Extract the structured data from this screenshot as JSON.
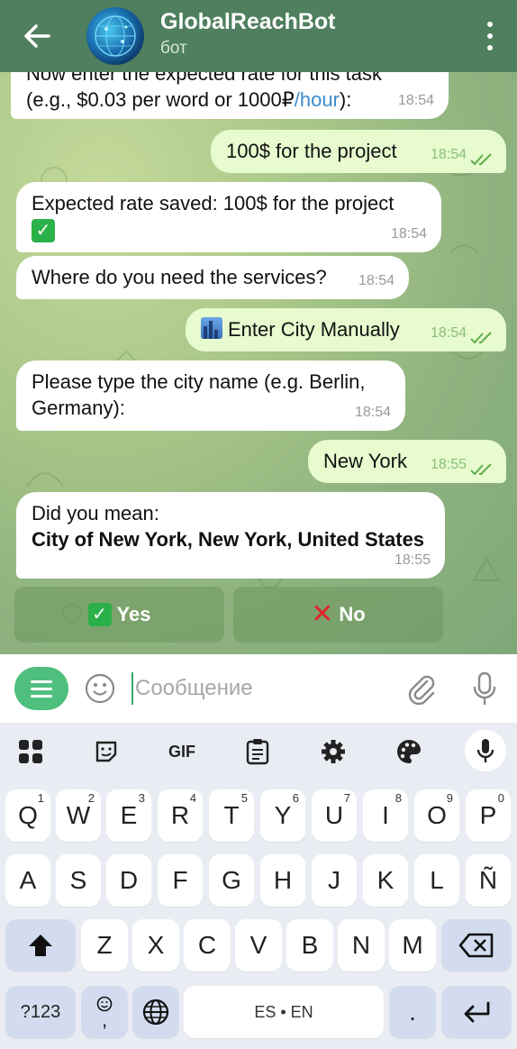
{
  "header": {
    "title": "GlobalReachBot",
    "subtitle": "бот"
  },
  "messages": [
    {
      "dir": "in",
      "line1": "Now enter the expected rate for this task",
      "line2_pre": "(e.g., $0.03 per word or 1000₽",
      "line2_link": "/hour",
      "line2_post": "):",
      "time": "18:54"
    },
    {
      "dir": "out",
      "text": "100$ for the project",
      "time": "18:54"
    },
    {
      "dir": "in",
      "text": "Expected rate saved: 100$ for the project",
      "emoji": "✓",
      "time": "18:54"
    },
    {
      "dir": "in",
      "text": "Where do you need the services?",
      "time": "18:54"
    },
    {
      "dir": "out",
      "text": "Enter City Manually",
      "time": "18:54"
    },
    {
      "dir": "in",
      "line1": "Please type the city name (e.g. Berlin,",
      "line2": "Germany):",
      "time": "18:54"
    },
    {
      "dir": "out",
      "text": "New York",
      "time": "18:55"
    },
    {
      "dir": "in",
      "line1": "Did you mean:",
      "line2": "City of New York, New York, United States",
      "time": "18:55"
    }
  ],
  "inline_keyboard": {
    "yes_label": "Yes",
    "no_label": "No"
  },
  "input": {
    "placeholder": "Сообщение",
    "value": ""
  },
  "keyboard": {
    "toolbar": [
      "apps-icon",
      "sticker-icon",
      "GIF",
      "clipboard-icon",
      "gear-icon",
      "palette-icon",
      "mic-icon"
    ],
    "gif_label": "GIF",
    "row1": [
      {
        "k": "Q",
        "n": "1"
      },
      {
        "k": "W",
        "n": "2"
      },
      {
        "k": "E",
        "n": "3"
      },
      {
        "k": "R",
        "n": "4"
      },
      {
        "k": "T",
        "n": "5"
      },
      {
        "k": "Y",
        "n": "6"
      },
      {
        "k": "U",
        "n": "7"
      },
      {
        "k": "I",
        "n": "8"
      },
      {
        "k": "O",
        "n": "9"
      },
      {
        "k": "P",
        "n": "0"
      }
    ],
    "row2": [
      "A",
      "S",
      "D",
      "F",
      "G",
      "H",
      "J",
      "K",
      "L",
      "Ñ"
    ],
    "row3": [
      "Z",
      "X",
      "C",
      "V",
      "B",
      "N",
      "M"
    ],
    "symbols_label": "?123",
    "space_label": "ES • EN",
    "period_label": ".",
    "comma_label": ","
  },
  "colors": {
    "header": "#4f7f5e",
    "accent": "#4fbf7e",
    "outgoing_bubble": "#e7fbcf",
    "incoming_bubble": "#ffffff"
  }
}
